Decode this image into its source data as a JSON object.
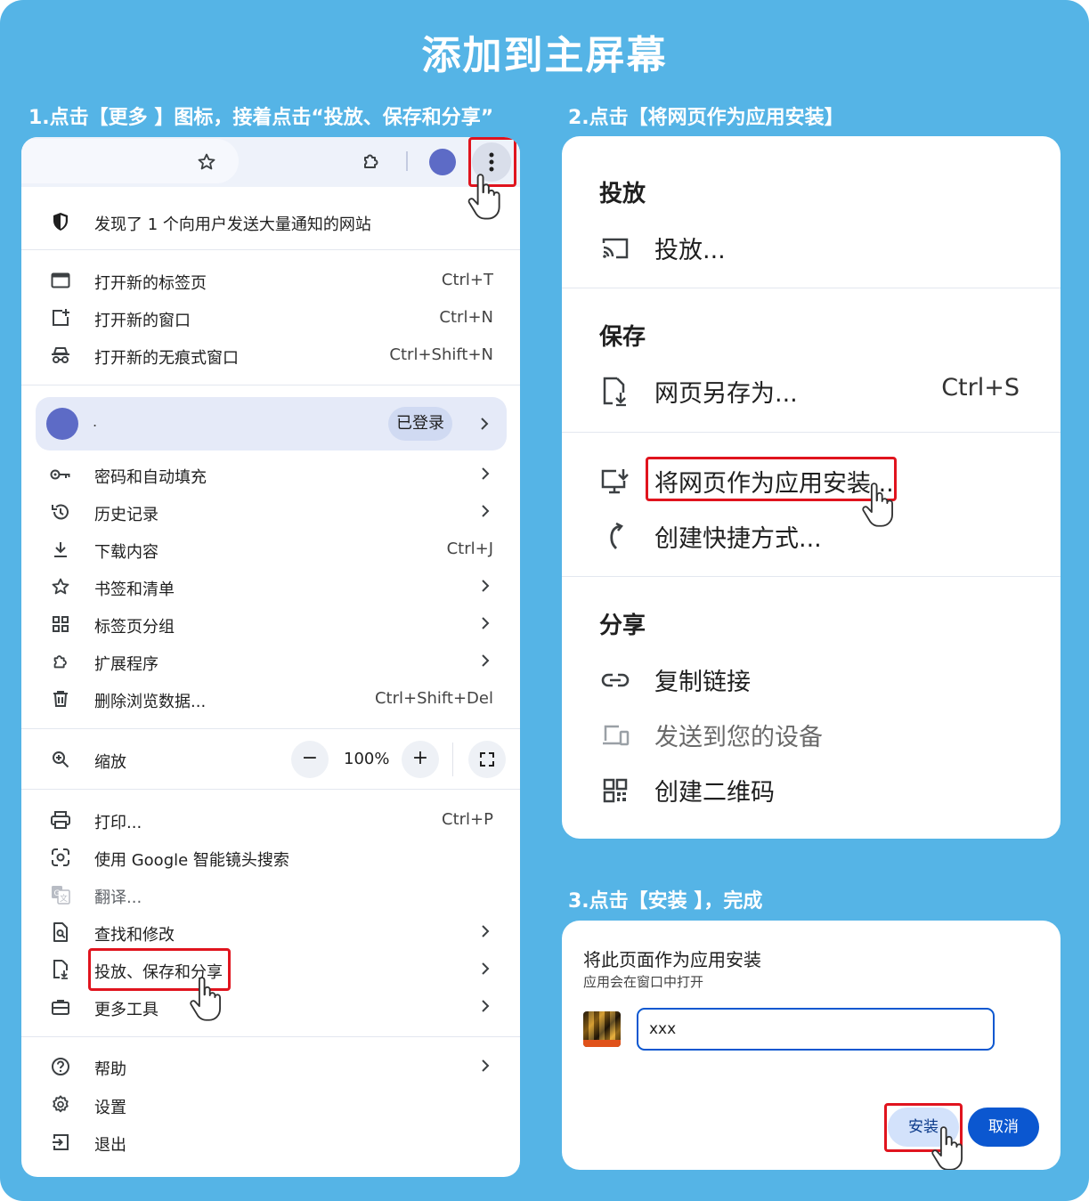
{
  "page": {
    "title": "添加到主屏幕"
  },
  "steps": {
    "step1": "1.点击【更多 】图标，接着点击“投放、保存和分享”",
    "step2": "2.点击【将网页作为应用安装】",
    "step3": "3.点击【安装 】，完成"
  },
  "menu": {
    "notice": "发现了 1 个向用户发送大量通知的网站",
    "new_tab": {
      "label": "打开新的标签页",
      "shortcut": "Ctrl+T"
    },
    "new_window": {
      "label": "打开新的窗口",
      "shortcut": "Ctrl+N"
    },
    "incognito": {
      "label": "打开新的无痕式窗口",
      "shortcut": "Ctrl+Shift+N"
    },
    "profile": {
      "name": ".",
      "badge": "已登录"
    },
    "passwords": "密码和自动填充",
    "history": "历史记录",
    "downloads": {
      "label": "下载内容",
      "shortcut": "Ctrl+J"
    },
    "bookmarks": "书签和清单",
    "tab_groups": "标签页分组",
    "extensions": "扩展程序",
    "clear_data": {
      "label": "删除浏览数据...",
      "shortcut": "Ctrl+Shift+Del"
    },
    "zoom": {
      "label": "缩放",
      "value": "100%",
      "minus": "−",
      "plus": "+"
    },
    "print": {
      "label": "打印...",
      "shortcut": "Ctrl+P"
    },
    "lens": "使用 Google 智能镜头搜索",
    "translate": "翻译...",
    "find": "查找和修改",
    "cast_save_share": "投放、保存和分享",
    "more_tools": "更多工具",
    "help": "帮助",
    "settings": "设置",
    "exit": "退出"
  },
  "submenu": {
    "cast_heading": "投放",
    "cast": "投放...",
    "save_heading": "保存",
    "save_as": {
      "label": "网页另存为...",
      "shortcut": "Ctrl+S"
    },
    "install_app": "将网页作为应用安装...",
    "shortcut": "创建快捷方式...",
    "share_heading": "分享",
    "copy_link": "复制链接",
    "send_devices": "发送到您的设备",
    "qr_code": "创建二维码"
  },
  "dialog": {
    "title": "将此页面作为应用安装",
    "subtitle": "应用会在窗口中打开",
    "name_value": "xxx",
    "install_label": "安装",
    "cancel_label": "取消"
  },
  "colors": {
    "background": "#55b4e6",
    "highlight_red": "#e0141e",
    "avatar": "#5d6bc6",
    "primary_button": "#0b57d0"
  }
}
